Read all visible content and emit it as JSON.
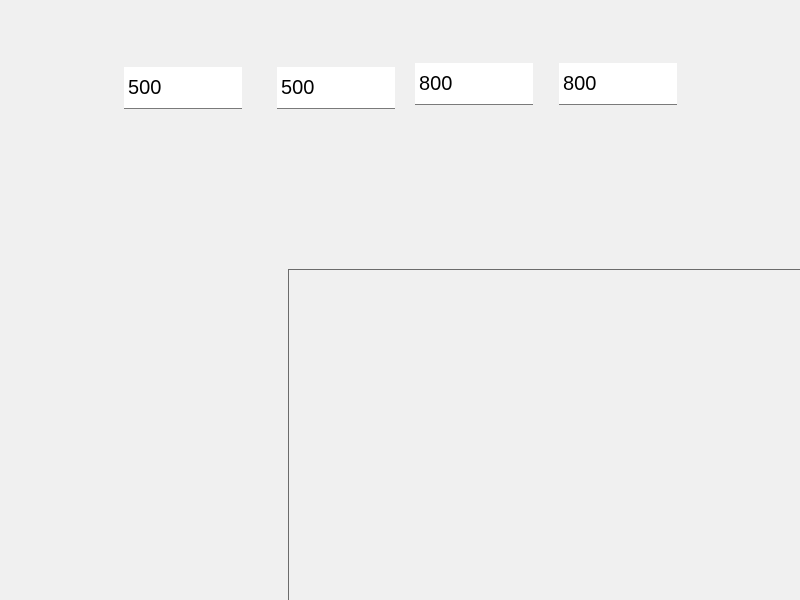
{
  "inputs": {
    "field_1": {
      "value": "500"
    },
    "field_2": {
      "value": "500"
    },
    "field_3": {
      "value": "800"
    },
    "field_4": {
      "value": "800"
    }
  },
  "colors": {
    "window_background": "#f0f0f0",
    "input_background": "#ffffff",
    "input_underline": "#7a7a7a",
    "canvas_border": "#6b6b6b"
  }
}
